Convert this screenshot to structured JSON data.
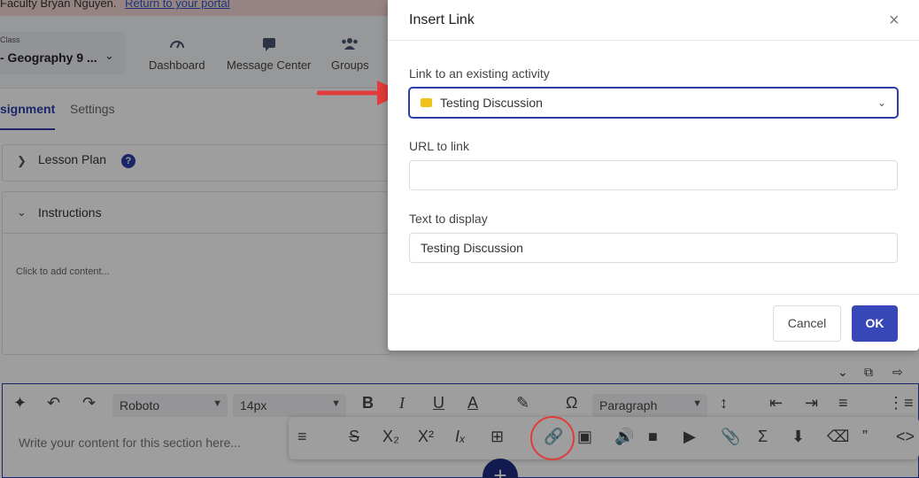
{
  "banner": {
    "text": "Faculty Bryan Nguyen.",
    "link": "Return to your portal"
  },
  "header": {
    "class_caption": "Class",
    "class_value": "- Geography 9 ...",
    "nav": [
      {
        "label": "Dashboard",
        "icon": "gauge-icon"
      },
      {
        "label": "Message Center",
        "icon": "chat-icon"
      },
      {
        "label": "Groups",
        "icon": "users-icon"
      }
    ]
  },
  "tabs": {
    "assignment": "signment",
    "settings": "Settings"
  },
  "sections": {
    "lesson_plan": "Lesson Plan",
    "instructions": "Instructions",
    "help": "?",
    "placeholder": "Click to add content..."
  },
  "editor": {
    "font": "Roboto",
    "size": "14px",
    "block": "Paragraph",
    "placeholder": "Write your content for this section here...",
    "fab": "+"
  },
  "modal": {
    "title": "Insert Link",
    "close": "×",
    "link_label": "Link to an existing activity",
    "link_value": "Testing Discussion",
    "url_label": "URL to link",
    "url_value": "",
    "text_label": "Text to display",
    "text_value": "Testing Discussion",
    "cancel": "Cancel",
    "ok": "OK"
  },
  "colors": {
    "primary": "#3847b8",
    "annotation_red": "#e23b3b",
    "activity_badge": "#f2c21c"
  }
}
